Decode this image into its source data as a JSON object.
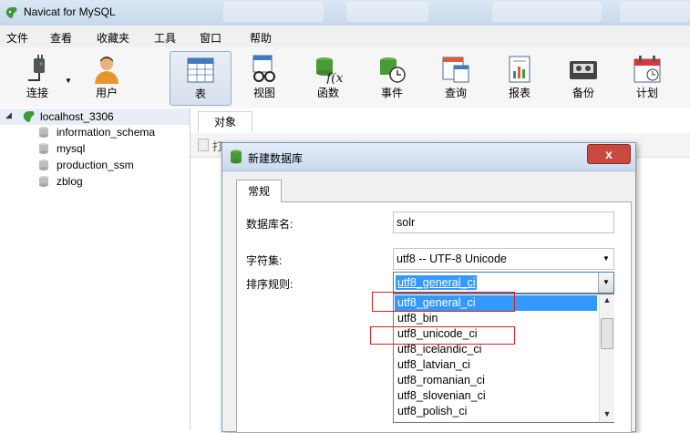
{
  "window": {
    "title": "Navicat for MySQL"
  },
  "menu": [
    "文件",
    "查看",
    "收藏夹",
    "工具",
    "窗口",
    "帮助"
  ],
  "toolbar": {
    "buttons": [
      {
        "label": "连接",
        "icon": "plug-icon"
      },
      {
        "label": "用户",
        "icon": "user-icon"
      },
      {
        "label": "表",
        "icon": "table-icon",
        "active": true
      },
      {
        "label": "视图",
        "icon": "view-glasses-icon"
      },
      {
        "label": "函数",
        "icon": "function-icon"
      },
      {
        "label": "事件",
        "icon": "event-clock-icon"
      },
      {
        "label": "查询",
        "icon": "query-icon"
      },
      {
        "label": "报表",
        "icon": "report-icon"
      },
      {
        "label": "备份",
        "icon": "backup-tape-icon"
      },
      {
        "label": "计划",
        "icon": "calendar-icon"
      }
    ]
  },
  "tree": {
    "connection": "localhost_3306",
    "databases": [
      "information_schema",
      "mysql",
      "production_ssm",
      "zblog"
    ]
  },
  "content": {
    "objects_tab": "对象",
    "toolbar_fragment": "打"
  },
  "dialog": {
    "title": "新建数据库",
    "close_glyph": "x",
    "tab": "常规",
    "fields": {
      "db_name_label": "数据库名:",
      "db_name_value": "solr",
      "charset_label": "字符集:",
      "charset_value": "utf8 -- UTF-8 Unicode",
      "collation_label": "排序规则:",
      "collation_value": "utf8_general_ci"
    },
    "collation_options": [
      "utf8_general_ci",
      "utf8_bin",
      "utf8_unicode_ci",
      "utf8_icelandic_ci",
      "utf8_latvian_ci",
      "utf8_romanian_ci",
      "utf8_slovenian_ci",
      "utf8_polish_ci"
    ],
    "selected_option_index": 0
  },
  "colors": {
    "selection": "#3399ff",
    "highlight_box": "#e02020",
    "title_bar": "#c7d8eb"
  }
}
